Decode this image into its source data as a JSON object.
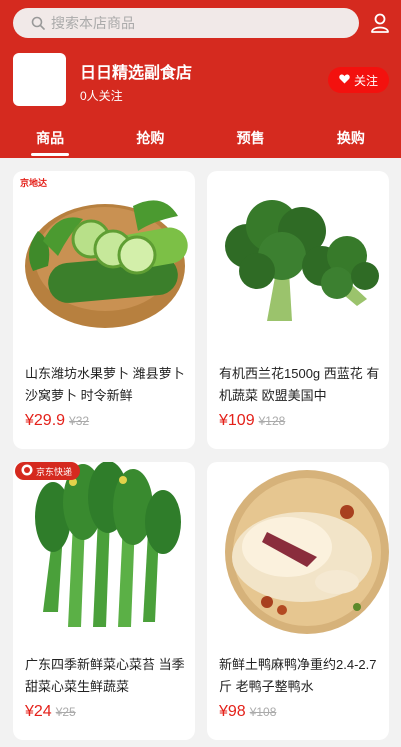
{
  "search": {
    "placeholder": "搜索本店商品"
  },
  "store": {
    "name": "日日精选副食店",
    "followers": "0人关注",
    "follow_label": "关注"
  },
  "tabs": [
    {
      "label": "商品",
      "active": true
    },
    {
      "label": "抢购",
      "active": false
    },
    {
      "label": "预售",
      "active": false
    },
    {
      "label": "换购",
      "active": false
    }
  ],
  "products": [
    {
      "title": "山东潍坊水果萝卜 潍县萝卜 沙窝萝卜 时令新鲜",
      "price": "¥29.9",
      "original_price": "¥32",
      "badge": "京地达"
    },
    {
      "title": "有机西兰花1500g 西蓝花 有机蔬菜 欧盟美国中",
      "price": "¥109",
      "original_price": "¥128",
      "badge": ""
    },
    {
      "title": "广东四季新鲜菜心菜苔 当季甜菜心菜生鲜蔬菜",
      "price": "¥24",
      "original_price": "¥25",
      "badge": "京东快递"
    },
    {
      "title": "新鲜土鸭麻鸭净重约2.4-2.7斤 老鸭子整鸭水",
      "price": "¥98",
      "original_price": "¥108",
      "badge": ""
    }
  ],
  "colors": {
    "header_bg": "#d52a1f",
    "price": "#e4211a",
    "follow_bg": "#f3110e"
  }
}
